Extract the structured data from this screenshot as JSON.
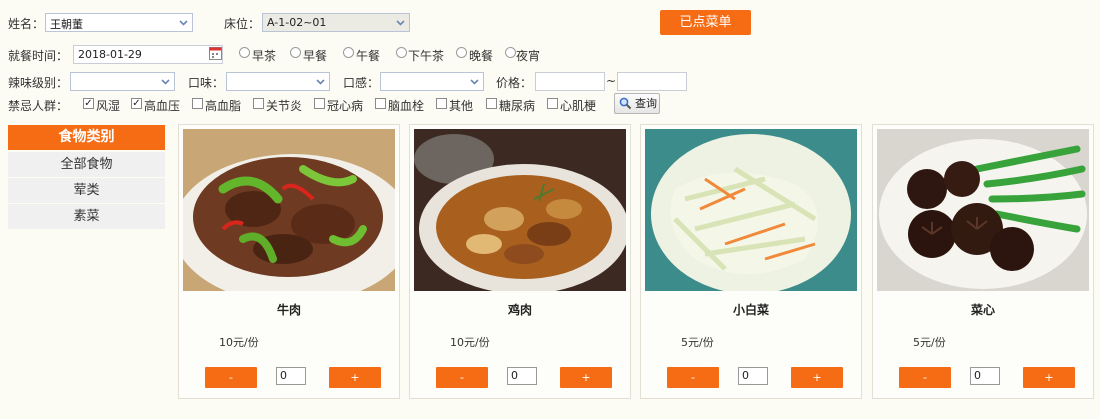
{
  "filters": {
    "name_label": "姓名：",
    "name_value": "王朝董",
    "bed_label": "床位：",
    "bed_value": "A-1-02~01",
    "ordered_button": "已点菜单",
    "meal_time_label": "就餐时间：",
    "meal_date": "2018-01-29",
    "meal_options": [
      "早茶",
      "早餐",
      "午餐",
      "下午茶",
      "晚餐",
      "夜宵"
    ],
    "spice_label": "辣味级别：",
    "taste_label": "口味：",
    "texture_label": "口感：",
    "price_label": "价格：",
    "price_sep": "~",
    "restriction_label": "禁忌人群：",
    "restrictions": [
      {
        "label": "风湿",
        "checked": true
      },
      {
        "label": "高血压",
        "checked": true
      },
      {
        "label": "高血脂",
        "checked": false
      },
      {
        "label": "关节炎",
        "checked": false
      },
      {
        "label": "冠心病",
        "checked": false
      },
      {
        "label": "脑血栓",
        "checked": false
      },
      {
        "label": "其他",
        "checked": false
      },
      {
        "label": "糖尿病",
        "checked": false
      },
      {
        "label": "心肌梗",
        "checked": false
      }
    ],
    "query_button": "查询"
  },
  "categories": {
    "title": "食物类别",
    "items": [
      "全部食物",
      "荤类",
      "素菜"
    ]
  },
  "foods": [
    {
      "name": "牛肉",
      "price": "10元/份",
      "qty": "0",
      "minus": "-",
      "plus": "+"
    },
    {
      "name": "鸡肉",
      "price": "10元/份",
      "qty": "0",
      "minus": "-",
      "plus": "+"
    },
    {
      "name": "小白菜",
      "price": "5元/份",
      "qty": "0",
      "minus": "-",
      "plus": "+"
    },
    {
      "name": "菜心",
      "price": "5元/份",
      "qty": "0",
      "minus": "-",
      "plus": "+"
    }
  ],
  "colors": {
    "accent": "#f66c15",
    "background": "#fcfbf4"
  }
}
